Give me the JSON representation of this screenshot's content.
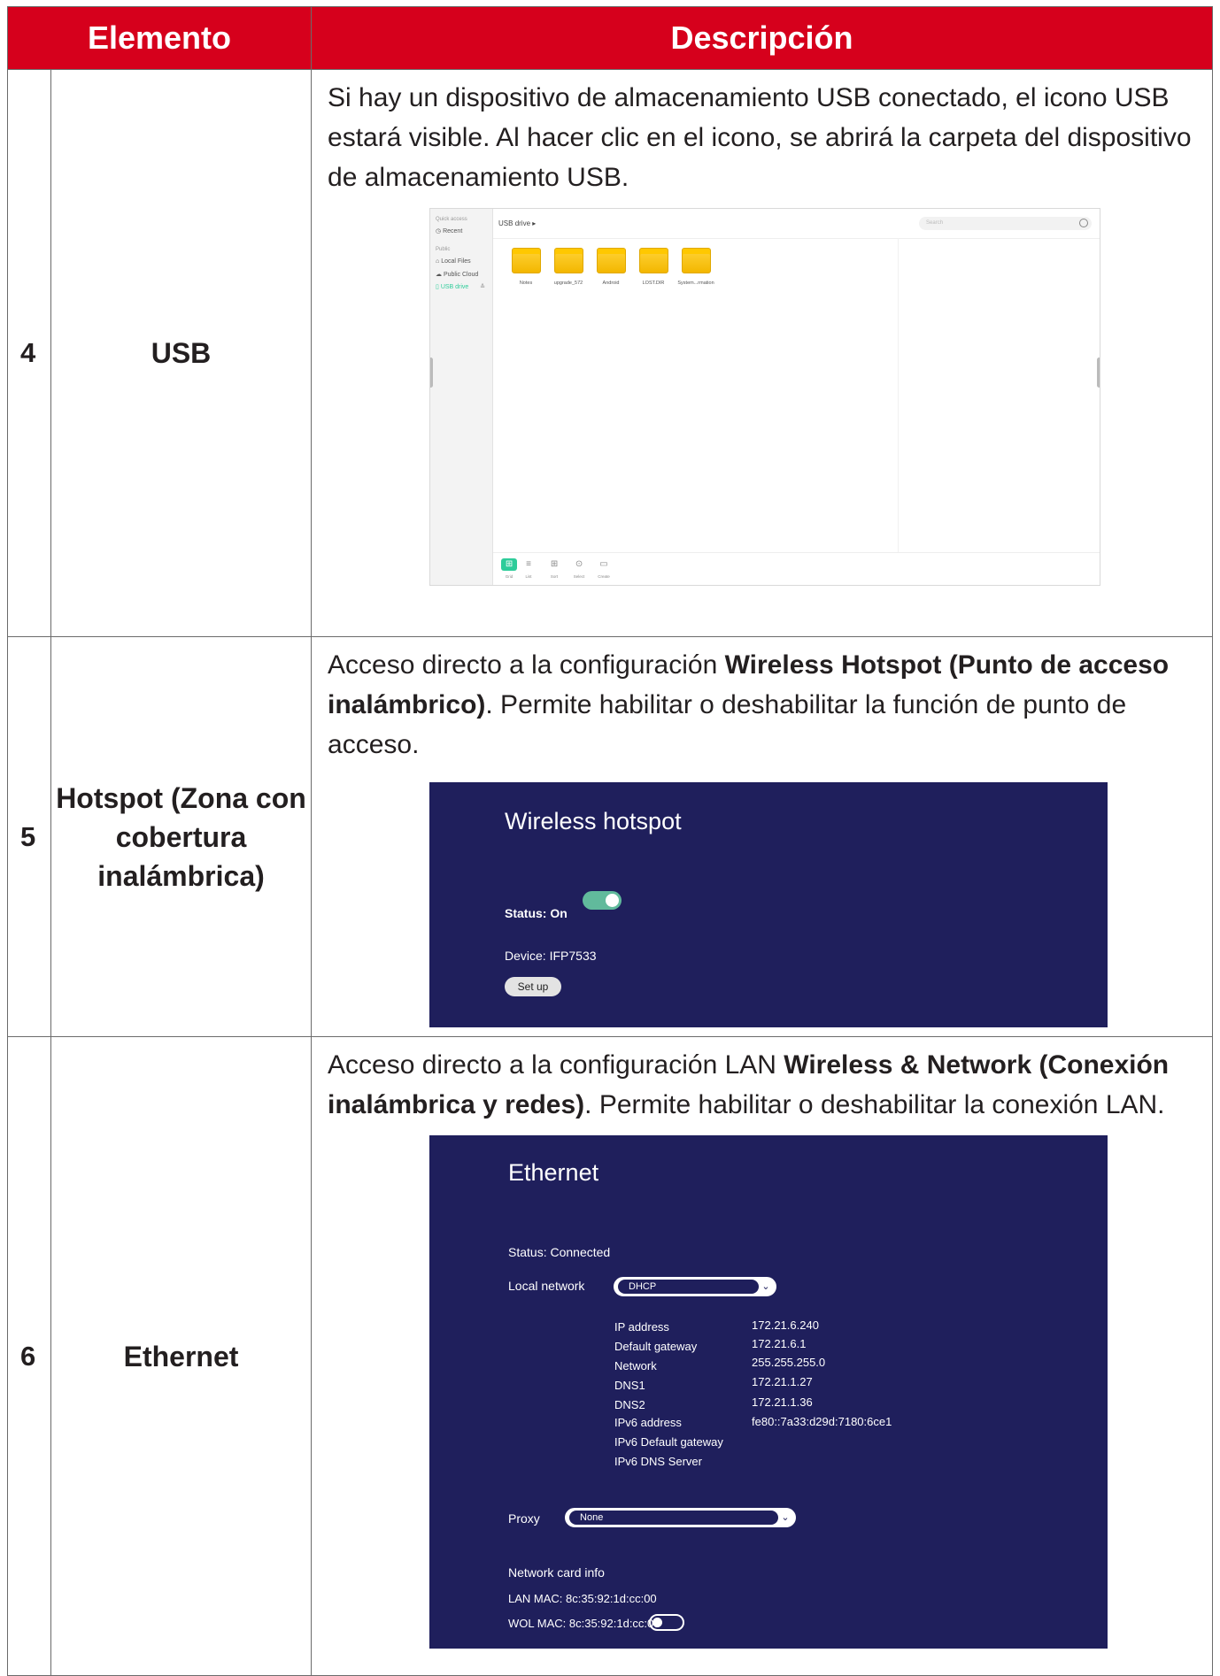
{
  "table": {
    "header_element": "Elemento",
    "header_description": "Descripción",
    "rows": [
      {
        "number": "4",
        "element": "USB",
        "description": "Si hay un dispositivo de almacenamiento USB conectado, el icono USB estará visible. Al hacer clic en el icono, se abrirá la carpeta del dispositivo de almacenamiento USB."
      },
      {
        "number": "5",
        "element": "Hotspot (Zona con cobertura inalámbrica)",
        "desc_pre": "Acceso directo a la configuración ",
        "desc_bold": "Wireless Hotspot (Punto de acceso inalámbrico)",
        "desc_post": ". Permite habilitar o deshabilitar la función de punto de acceso."
      },
      {
        "number": "6",
        "element": "Ethernet",
        "desc_pre": "Acceso directo a la configuración LAN ",
        "desc_bold": "Wireless & Network (Conexión inalámbrica y redes)",
        "desc_post": ". Permite habilitar o deshabilitar la conexión LAN."
      }
    ]
  },
  "file_manager": {
    "quick_access_label": "Quick access",
    "recent": "Recent",
    "public_label": "Public",
    "local_files": "Local Files",
    "public_cloud": "Public Cloud",
    "usb_drive": "USB drive",
    "path": "USB drive  ▸",
    "search_placeholder": "Search",
    "folders": [
      "Notes",
      "upgrade_572",
      "Android",
      "LOST.DIR",
      "System...rmation"
    ],
    "toolbar": [
      "Grid",
      "List",
      "Sort",
      "Select",
      "Create"
    ],
    "accent_color": "#2ecc9a"
  },
  "hotspot": {
    "title": "Wireless hotspot",
    "status": "Status: On",
    "device": "Device:  IFP7533",
    "setup_button": "Set up",
    "background_color": "#1f1f5c",
    "toggle_color": "#61ba9c"
  },
  "ethernet": {
    "title": "Ethernet",
    "status": "Status: Connected",
    "local_network_label": "Local network",
    "local_network_value": "DHCP",
    "ip_labels": [
      "IP address",
      "Default gateway",
      "Network",
      "DNS1",
      "DNS2",
      "IPv6 address",
      "IPv6 Default gateway",
      "IPv6 DNS Server"
    ],
    "ip_values": [
      "172.21.6.240",
      "172.21.6.1",
      "255.255.255.0",
      "172.21.1.27",
      "172.21.1.36",
      "fe80::7a33:d29d:7180:6ce1"
    ],
    "proxy_label": "Proxy",
    "proxy_value": "None",
    "card_info_label": "Network card info",
    "lan_mac": "LAN MAC: 8c:35:92:1d:cc:00",
    "wol_mac": "WOL MAC: 8c:35:92:1d:cc:00"
  }
}
